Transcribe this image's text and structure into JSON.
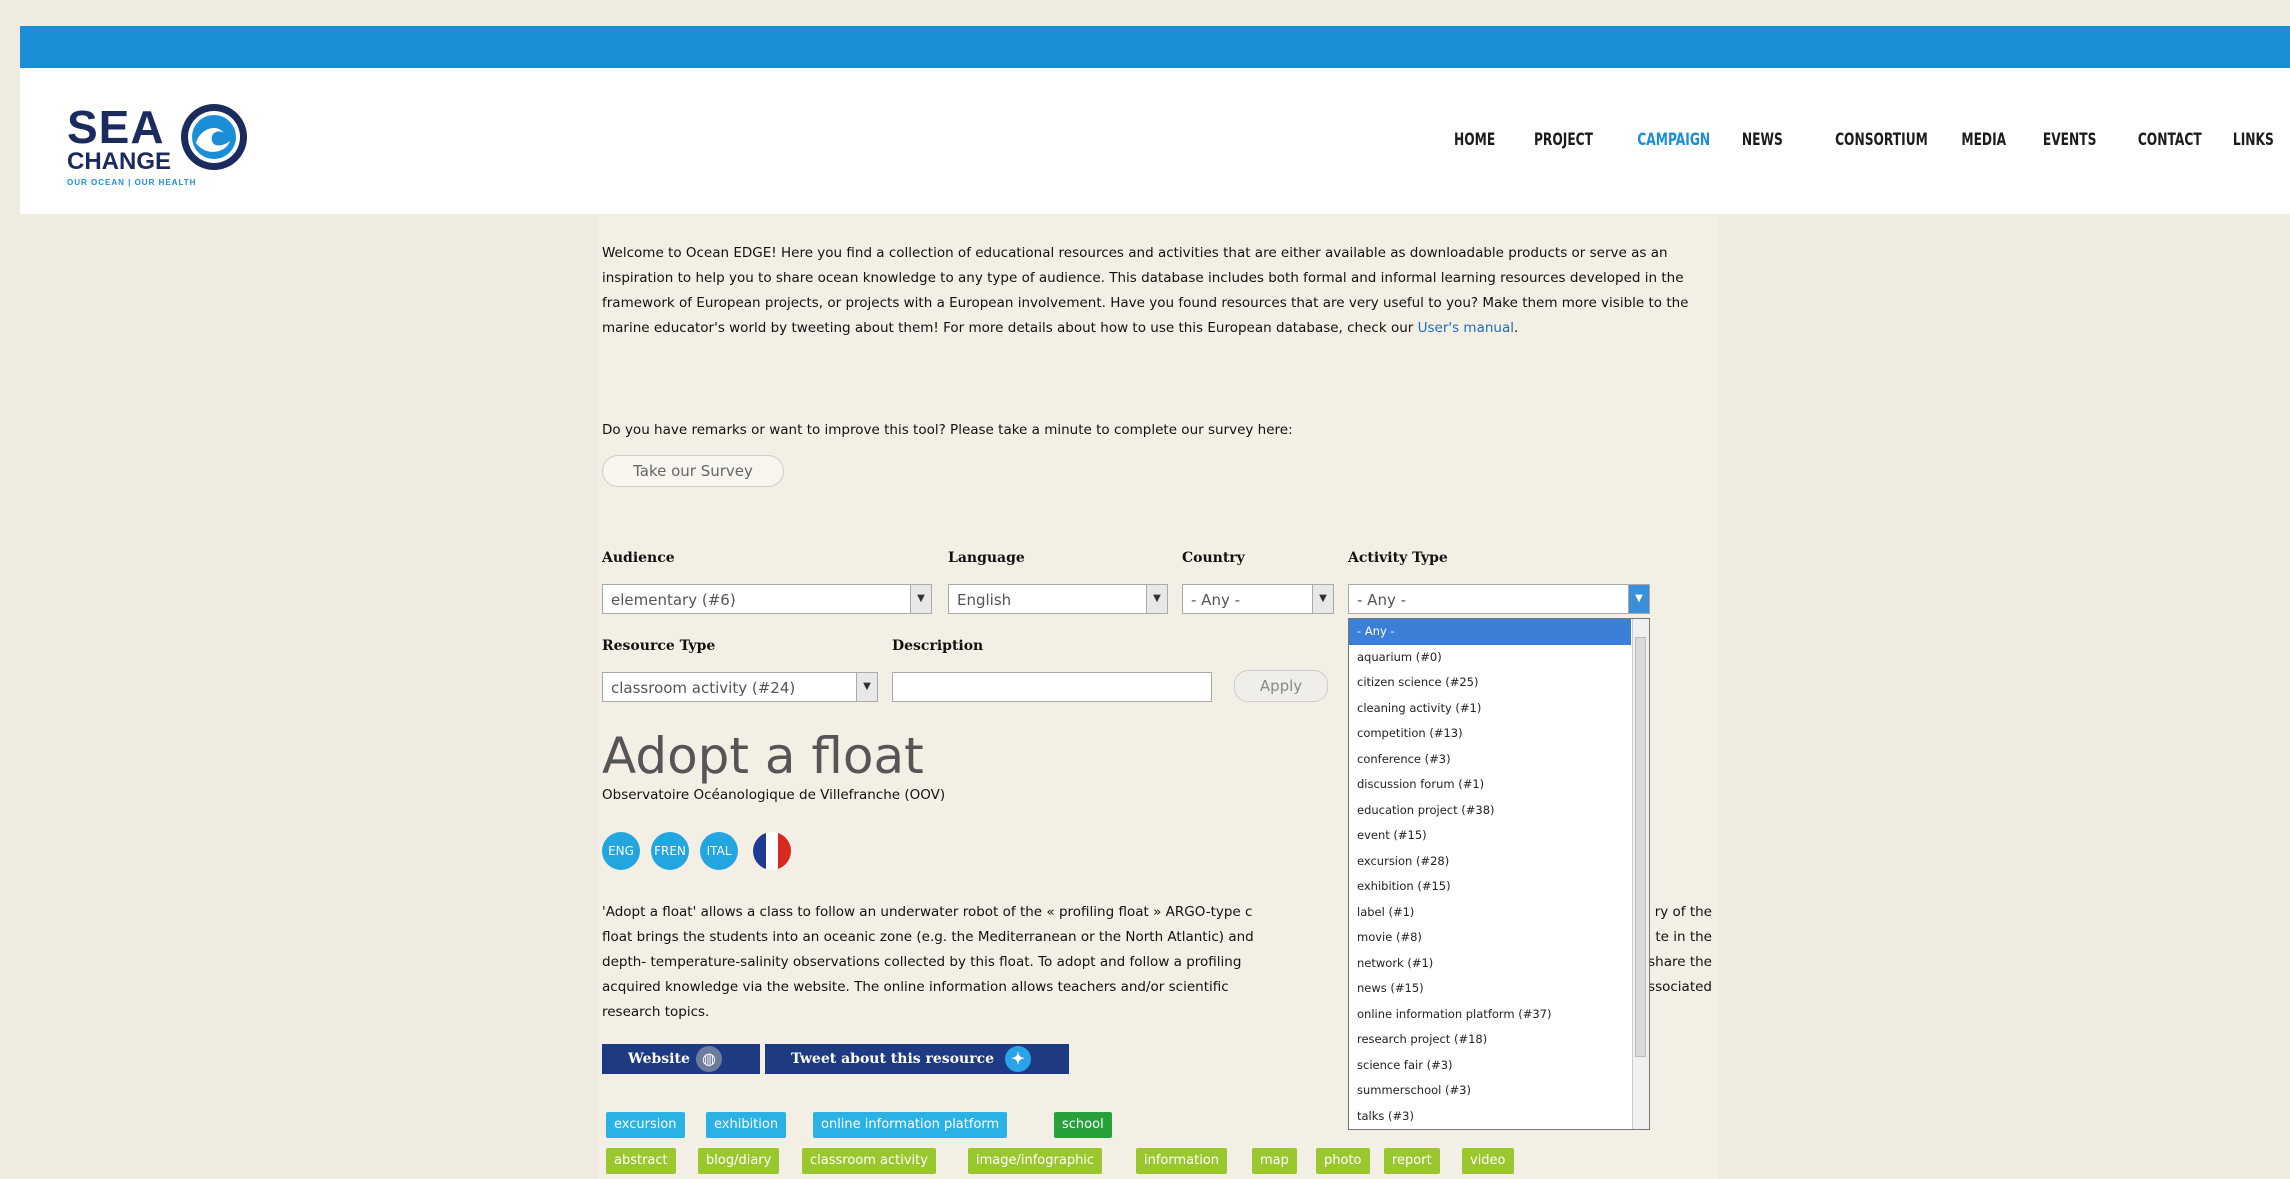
{
  "logo": {
    "line1": "SEA",
    "line2": "CHANGE",
    "tagline": "OUR OCEAN | OUR HEALTH"
  },
  "nav": [
    "HOME",
    "PROJECT",
    "CAMPAIGN",
    "NEWS",
    "CONSORTIUM",
    "MEDIA",
    "EVENTS",
    "CONTACT",
    "LINKS"
  ],
  "nav_active": "CAMPAIGN",
  "intro": {
    "text": "Welcome to Ocean EDGE! Here you find a collection of educational resources and activities that are either available as downloadable products or serve as an inspiration to help you to share ocean knowledge to any type of audience. This database includes both formal and informal learning resources developed in the framework of European projects, or projects with a European involvement. Have you found resources that are very useful to you? Make them more visible to the marine educator's world by tweeting about them! For more details about how to use this European database, check our ",
    "link": "User's manual",
    "end": "."
  },
  "survey": {
    "question": "Do you have remarks or want to improve this tool? Please take a minute to complete our survey here:",
    "button": "Take our Survey"
  },
  "filters": {
    "audience_label": "Audience",
    "audience_value": "elementary (#6)",
    "language_label": "Language",
    "language_value": "English",
    "country_label": "Country",
    "country_value": "- Any -",
    "activity_label": "Activity Type",
    "activity_value": "- Any -",
    "resource_label": "Resource Type",
    "resource_value": "classroom activity (#24)",
    "description_label": "Description",
    "description_value": "",
    "apply": "Apply"
  },
  "activity_options": [
    "- Any -",
    "aquarium (#0)",
    "citizen science (#25)",
    "cleaning activity (#1)",
    "competition (#13)",
    "conference (#3)",
    "discussion forum (#1)",
    "education project (#38)",
    "event (#15)",
    "excursion (#28)",
    "exhibition (#15)",
    "label (#1)",
    "movie (#8)",
    "network (#1)",
    "news (#15)",
    "online information platform (#37)",
    "research project (#18)",
    "science fair (#3)",
    "summerschool (#3)",
    "talks (#3)"
  ],
  "resource": {
    "title": "Adopt a float",
    "org": "Observatoire Océanologique de Villefranche (OOV)",
    "langs": [
      "ENG",
      "FREN",
      "ITAL"
    ],
    "flag_colors": [
      "#1f3a93",
      "#ffffff",
      "#d52b1e"
    ],
    "desc_lines": [
      "'Adopt a float' allows a class to follow an underwater robot of the « profiling float » ARGO-type c",
      "float brings the students into an oceanic zone (e.g. the Mediterranean or the North Atlantic) and",
      "depth- temperature-salinity observations collected by this float. To adopt and follow a profiling",
      "acquired knowledge via the website. The online information allows teachers and/or scientific",
      "research topics."
    ],
    "desc_right": [
      "ry of the",
      "te in the",
      "share the",
      "associated"
    ],
    "website": "Website",
    "tweet": "Tweet about this resource"
  },
  "tags_row1": [
    {
      "label": "excursion",
      "color": "blue"
    },
    {
      "label": "exhibition",
      "color": "blue"
    },
    {
      "label": "online information platform",
      "color": "blue"
    },
    {
      "label": "school",
      "color": "green"
    }
  ],
  "tags_row2": [
    "abstract",
    "blog/diary",
    "classroom activity",
    "image/infographic",
    "information",
    "map",
    "photo",
    "report",
    "video"
  ],
  "colors": {
    "topbar": "#1a8fd8",
    "navy": "#1d3a82",
    "tag_blue": "#29b2e3",
    "tag_green": "#27a13a",
    "tag_lime": "#9bc72e"
  }
}
